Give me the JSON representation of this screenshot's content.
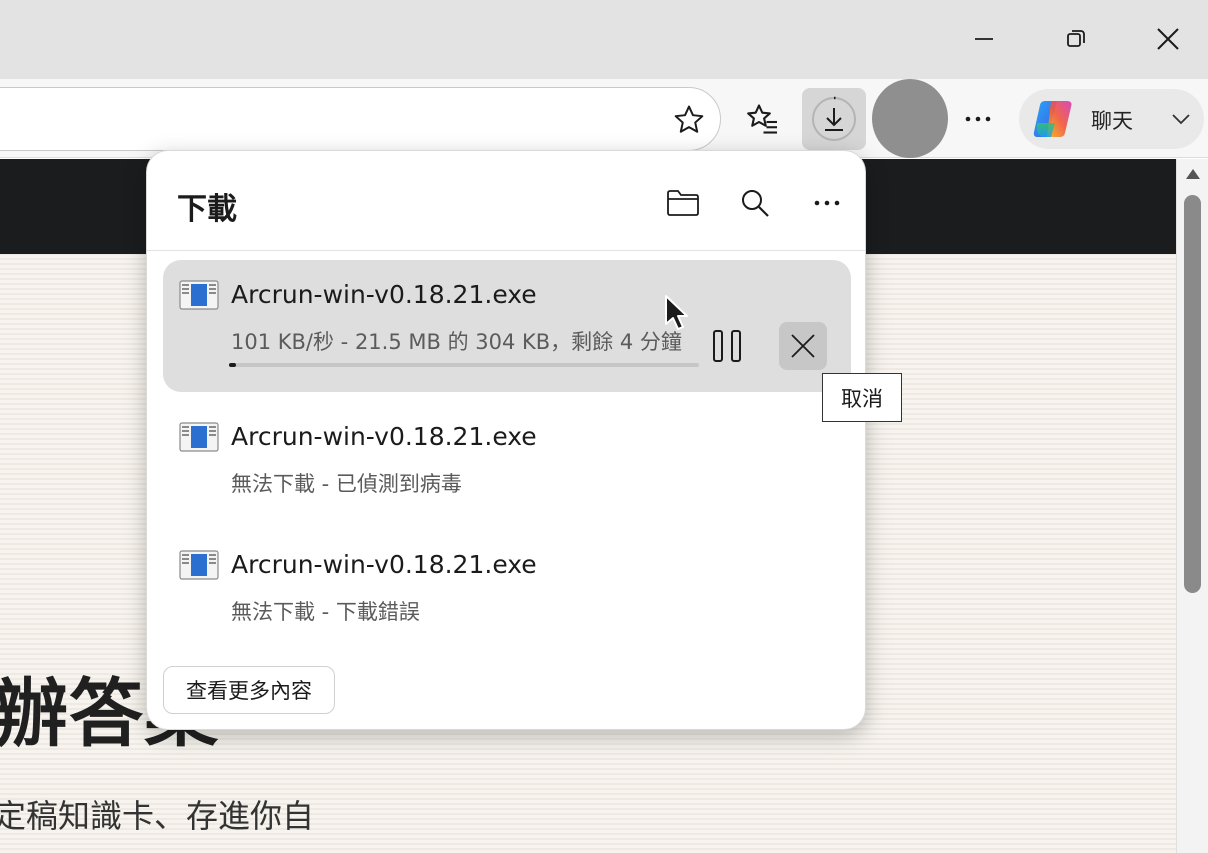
{
  "window": {
    "controls": [
      "minimize",
      "restore",
      "close"
    ]
  },
  "toolbar": {
    "copilot_label": "聊天"
  },
  "page": {
    "heading": "辦答案",
    "subtext": "定稿知識卡、存進你自"
  },
  "downloads": {
    "title": "下載",
    "items": [
      {
        "file_name": "Arcrun-win-v0.18.21.exe",
        "status": "101 KB/秒 - 21.5 MB 的 304 KB，剩餘 4 分鐘",
        "progress": 0.014,
        "active": true
      },
      {
        "file_name": "Arcrun-win-v0.18.21.exe",
        "status": "無法下載 - 已偵測到病毒"
      },
      {
        "file_name": "Arcrun-win-v0.18.21.exe",
        "status": "無法下載 - 下載錯誤"
      }
    ],
    "see_more_label": "查看更多內容",
    "cancel_tooltip": "取消"
  },
  "colors": {
    "titlebar": "#e3e3e3",
    "toolbar": "#f7f7f7",
    "active_item": "#dedede",
    "page_nav": "#1b1c1e"
  }
}
